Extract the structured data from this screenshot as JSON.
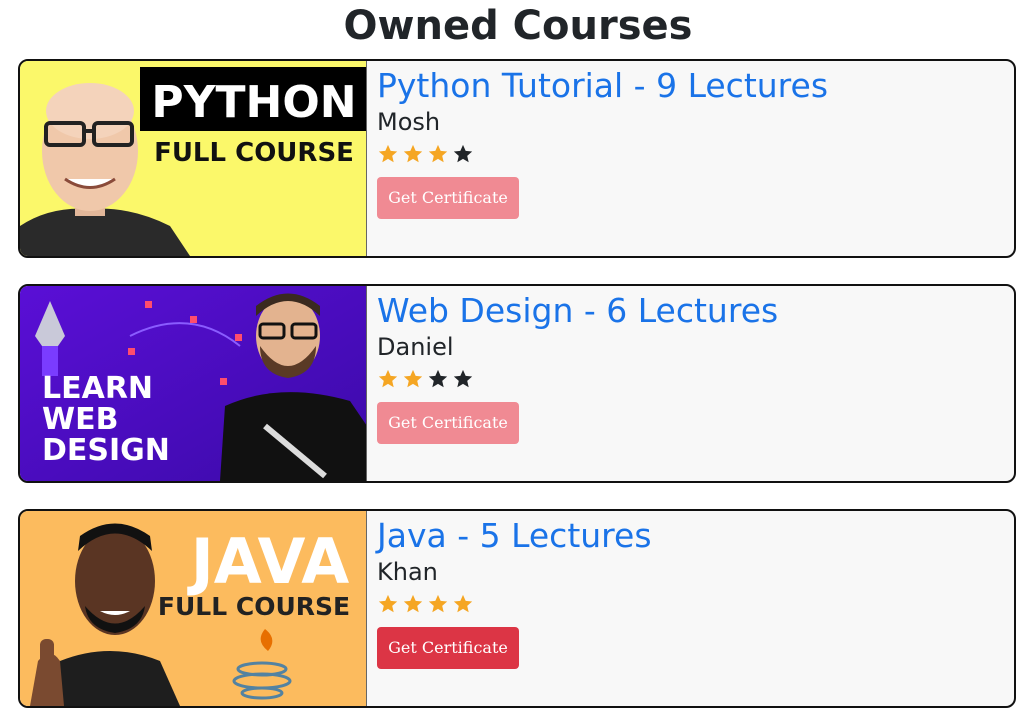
{
  "page": {
    "title": "Owned Courses"
  },
  "colors": {
    "accent": "#1a73e8",
    "star_filled": "#f5a623",
    "star_empty": "#212529",
    "button_enabled": "#dc3545",
    "button_disabled": "#f08a93"
  },
  "courses": [
    {
      "title": "Python Tutorial - 9 Lectures",
      "author": "Mosh",
      "rating": 3,
      "rating_max": 4,
      "button_label": "Get Certificate",
      "button_enabled": false,
      "thumb": {
        "line1": "PYTHON",
        "line2": "FULL COURSE"
      }
    },
    {
      "title": "Web Design - 6 Lectures",
      "author": "Daniel",
      "rating": 2,
      "rating_max": 4,
      "button_label": "Get Certificate",
      "button_enabled": false,
      "thumb": {
        "line1": "LEARN",
        "line2": "WEB",
        "line3": "DESIGN"
      }
    },
    {
      "title": "Java - 5 Lectures",
      "author": "Khan",
      "rating": 4,
      "rating_max": 4,
      "button_label": "Get Certificate",
      "button_enabled": true,
      "thumb": {
        "line1": "JAVA",
        "line2": "FULL COURSE"
      }
    }
  ]
}
